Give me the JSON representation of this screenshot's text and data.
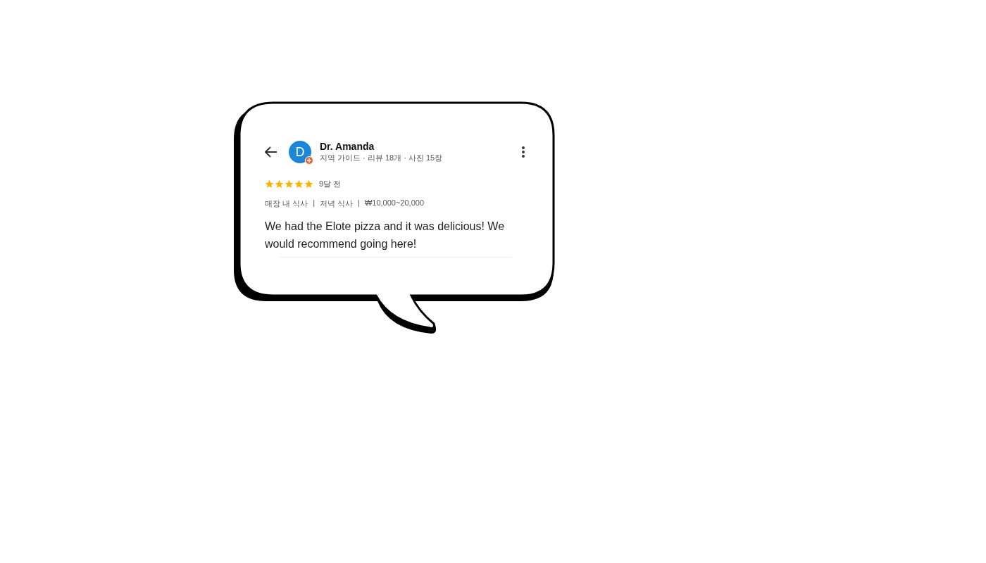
{
  "review": {
    "author": "Dr. Amanda",
    "avatar_letter": "D",
    "author_info": "지역 가이드 · 리뷰 18개 · 사진 15장",
    "stars": 5,
    "time": "9달 전",
    "meta": [
      "매장 내 식사",
      "|",
      "저녁 식사",
      "|",
      "₩10,000~20,000"
    ],
    "text": "We had the Elote pizza and it was delicious! We would recommend going here!"
  }
}
